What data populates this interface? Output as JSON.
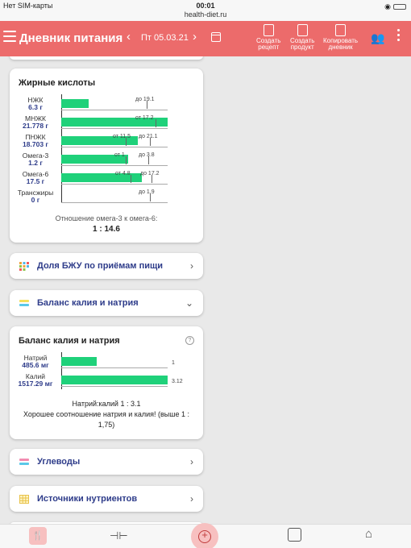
{
  "status_bar": {
    "carrier": "Нет SIM-карты",
    "time": "00:01",
    "url": "health-diet.ru"
  },
  "topbar": {
    "title": "Дневник питания",
    "date": "Пт 05.03.21",
    "actions": [
      {
        "line1": "Создать",
        "line2": "рецепт"
      },
      {
        "line1": "Создать",
        "line2": "продукт"
      },
      {
        "line1": "Копировать",
        "line2": "дневник"
      }
    ]
  },
  "fatty_acids": {
    "title": "Жирные кислоты",
    "rows": [
      {
        "name": "НЖК",
        "value": "6.3 г",
        "min_label": "",
        "max_label": "до 19.1",
        "fill_pct": 26
      },
      {
        "name": "МНЖК",
        "value": "21.778 г",
        "min_label": "от 17.2",
        "max_label": "",
        "fill_pct": 100
      },
      {
        "name": "ПНЖК",
        "value": "18.703 г",
        "min_label": "от 11.5",
        "max_label": "до 21.1",
        "fill_pct": 72
      },
      {
        "name": "Омега-3",
        "value": "1.2 г",
        "min_label": "от 1",
        "max_label": "до 3.8",
        "fill_pct": 63
      },
      {
        "name": "Омега-6",
        "value": "17.5 г",
        "min_label": "от 4.8",
        "max_label": "до 17.2",
        "fill_pct": 76
      },
      {
        "name": "Трансжиры",
        "value": "0 г",
        "min_label": "",
        "max_label": "до 1.9",
        "fill_pct": 0
      }
    ],
    "ratio_caption": "Отношение омега-3 к омега-6:",
    "ratio_value": "1 : 14.6"
  },
  "nav_macros": {
    "label": "Доля БЖУ по приёмам пищи"
  },
  "nav_balance": {
    "label": "Баланс калия и натрия"
  },
  "balance": {
    "title": "Баланс калия и натрия",
    "rows": [
      {
        "name": "Натрий",
        "value": "485.6 мг",
        "end_label": "1",
        "fill_pct": 33
      },
      {
        "name": "Калий",
        "value": "1517.29 мг",
        "end_label": "3.12",
        "fill_pct": 100
      }
    ],
    "ratio_text": "Натрий:калий 1 : 3.1",
    "verdict_text": "Хорошее соотношение натрия и калия! (выше 1 : 1,75)"
  },
  "nav_carbs": {
    "label": "Углеводы"
  },
  "nav_sources": {
    "label": "Источники нутриентов"
  },
  "icons": [
    "menu-icon",
    "calendar-icon",
    "recipe-icon",
    "product-icon",
    "copy-diary-icon",
    "users-icon",
    "more-icon",
    "macros-icon",
    "balance-icon",
    "carbs-icon",
    "sources-icon",
    "help-icon",
    "chevron-right-icon",
    "chevron-down-icon",
    "diary-icon",
    "workout-icon",
    "add-icon",
    "scale-icon",
    "home-icon"
  ],
  "colors": {
    "topbar": "#ec6b6b",
    "bar": "#1fd17a",
    "accent_text": "#2e3c8a"
  }
}
